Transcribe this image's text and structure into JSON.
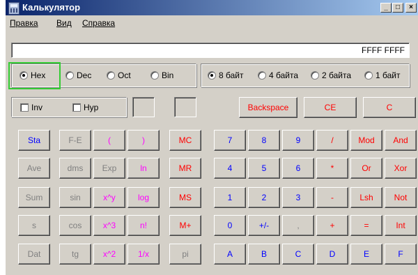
{
  "window": {
    "title": "Калькулятор",
    "controls": [
      "_",
      "□",
      "×"
    ]
  },
  "menu": [
    "Правка",
    "Вид",
    "Справка"
  ],
  "display": {
    "value": "FFFF FFFF"
  },
  "number_system": {
    "options": [
      "Hex",
      "Dec",
      "Oct",
      "Bin"
    ],
    "selected": "Hex"
  },
  "word_size": {
    "options": [
      "8 байт",
      "4 байта",
      "2 байта",
      "1 байт"
    ],
    "selected": "8 байт"
  },
  "checkboxes": {
    "inv": "Inv",
    "hyp": "Hyp"
  },
  "edit_buttons": {
    "backspace": "Backspace",
    "ce": "CE",
    "c": "C"
  },
  "stat_buttons": [
    "Sta",
    "Ave",
    "Sum",
    "s",
    "Dat"
  ],
  "sci_col1": [
    "F-E",
    "dms",
    "sin",
    "cos",
    "tg"
  ],
  "sci_col2": [
    "(",
    "Exp",
    "x^y",
    "x^3",
    "x^2"
  ],
  "sci_col3": [
    ")",
    "ln",
    "log",
    "n!",
    "1/x"
  ],
  "memory_buttons": [
    "MC",
    "MR",
    "MS",
    "M+",
    "pi"
  ],
  "digits": {
    "r1": [
      "7",
      "8",
      "9"
    ],
    "r2": [
      "4",
      "5",
      "6"
    ],
    "r3": [
      "1",
      "2",
      "3"
    ],
    "r4": [
      "0",
      "+/-",
      ","
    ]
  },
  "operators": [
    "/",
    "*",
    "-",
    "+",
    "="
  ],
  "logic_col1": [
    "Mod",
    "Or",
    "Lsh",
    "=",
    "E"
  ],
  "logic_col2": [
    "And",
    "Xor",
    "Not",
    "Int",
    "F"
  ],
  "hex_row": [
    "A",
    "B",
    "C",
    "D"
  ],
  "colors": {
    "title_start": "#0a246a",
    "title_end": "#a6caf0",
    "face": "#d4d0c8",
    "highlight": "#33cc33"
  }
}
